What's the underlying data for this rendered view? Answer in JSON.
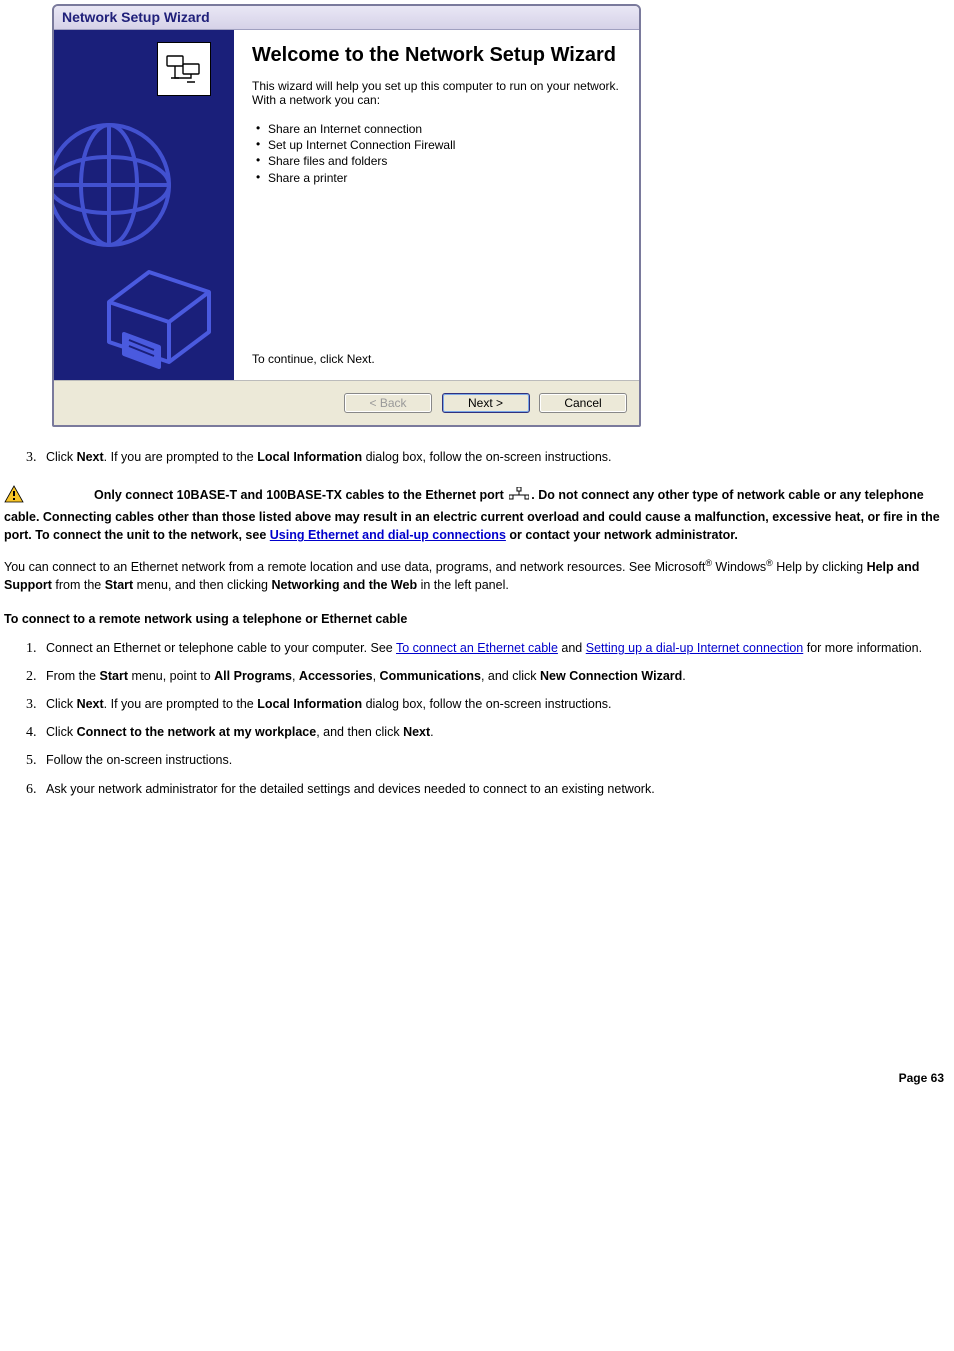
{
  "wizard": {
    "title": "Network Setup Wizard",
    "heading": "Welcome to the Network Setup Wizard",
    "intro": "This wizard will help you set up this computer to run on your network. With a network you can:",
    "bullets": [
      "Share an Internet connection",
      "Set up Internet Connection Firewall",
      "Share files and folders",
      "Share a printer"
    ],
    "continue_text": "To continue, click Next.",
    "buttons": {
      "back": "< Back",
      "next": "Next >",
      "cancel": "Cancel"
    }
  },
  "step3": {
    "pre": "Click ",
    "b1": "Next",
    "mid": ". If you are prompted to the ",
    "b2": "Local Information",
    "post": " dialog box, follow the on-screen instructions."
  },
  "caution": {
    "b_start": "Only connect 10BASE-T and 100BASE-TX cables to the Ethernet port ",
    "b_after_icon": ". Do not connect any other type of network cable or any telephone cable. Connecting cables other than those listed above may result in an electric current overload and could cause a malfunction, excessive heat, or fire in the port. To connect the unit to the network, see ",
    "link": "Using Ethernet and dial-up connections",
    "b_end": " or contact your network administrator."
  },
  "remote_para": {
    "t1": "You can connect to an Ethernet network from a remote location and use data, programs, and network resources. See Microsoft",
    "t2": " Windows",
    "t3": " Help by clicking ",
    "b1": "Help and Support",
    "t4": " from the ",
    "b2": "Start",
    "t5": " menu, and then clicking ",
    "b3": "Networking and the Web",
    "t6": " in the left panel."
  },
  "section_heading": "To connect to a remote network using a telephone or Ethernet cable",
  "steps2": {
    "s1": {
      "t1": "Connect an Ethernet or telephone cable to your computer. See ",
      "l1": "To connect an Ethernet cable",
      "t2": " and ",
      "l2": "Setting up a dial-up Internet connection",
      "t3": " for more information."
    },
    "s2": {
      "t1": "From the ",
      "b1": "Start",
      "t2": " menu, point to ",
      "b2": "All Programs",
      "t3": ", ",
      "b3": "Accessories",
      "t4": ", ",
      "b4": "Communications",
      "t5": ", and click ",
      "b5": "New Connection Wizard",
      "t6": "."
    },
    "s3": {
      "t1": "Click ",
      "b1": "Next",
      "t2": ". If you are prompted to the ",
      "b2": "Local Information",
      "t3": " dialog box, follow the on-screen instructions."
    },
    "s4": {
      "t1": "Click ",
      "b1": "Connect to the network at my workplace",
      "t2": ", and then click ",
      "b2": "Next",
      "t3": "."
    },
    "s5": "Follow the on-screen instructions.",
    "s6": "Ask your network administrator for the detailed settings and devices needed to connect to an existing network."
  },
  "page_number": "Page 63"
}
